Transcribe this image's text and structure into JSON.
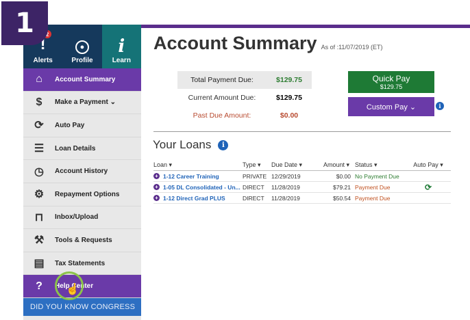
{
  "step_badge": "1",
  "sidebar": {
    "top_icons": [
      {
        "label": "Alerts",
        "icon": "alert-icon",
        "badge": "2"
      },
      {
        "label": "Profile",
        "icon": "profile-icon"
      },
      {
        "label": "Learn",
        "icon": "info-italic-icon",
        "glyph": "i"
      }
    ],
    "items": [
      {
        "label": "Account Summary",
        "icon": "home-icon",
        "glyph": "⌂"
      },
      {
        "label": "Make a Payment ⌄",
        "icon": "dollar-icon",
        "glyph": "$"
      },
      {
        "label": "Auto Pay",
        "icon": "autopay-icon",
        "glyph": "⟳"
      },
      {
        "label": "Loan Details",
        "icon": "list-icon",
        "glyph": "☰"
      },
      {
        "label": "Account History",
        "icon": "clock-icon",
        "glyph": "◷"
      },
      {
        "label": "Repayment Options",
        "icon": "gear-icon",
        "glyph": "⚙"
      },
      {
        "label": "Inbox/Upload",
        "icon": "inbox-icon",
        "glyph": "⊓"
      },
      {
        "label": "Tools & Requests",
        "icon": "wrench-icon",
        "glyph": "⚒"
      },
      {
        "label": "Tax Statements",
        "icon": "document-icon",
        "glyph": "▤"
      },
      {
        "label": "Help Center",
        "icon": "help-icon",
        "glyph": "?"
      }
    ],
    "banner": "DID YOU KNOW CONGRESS"
  },
  "main": {
    "title": "Account Summary",
    "as_of": "As of :11/07/2019 (ET)",
    "summary": {
      "total_label": "Total Payment Due:",
      "total_value": "$129.75",
      "current_label": "Current Amount Due:",
      "current_value": "$129.75",
      "past_label": "Past Due Amount:",
      "past_value": "$0.00"
    },
    "quick_pay": {
      "label": "Quick Pay",
      "amount": "$129.75"
    },
    "custom_pay": "Custom Pay ⌄",
    "loans_title": "Your Loans",
    "loan_columns": [
      "Loan ▾",
      "Type ▾",
      "Due Date ▾",
      "Amount ▾",
      "Status ▾",
      "Auto Pay ▾"
    ],
    "loans": [
      {
        "name": "1-12 Career Training",
        "type": "PRIVATE",
        "due": "12/29/2019",
        "amount": "$0.00",
        "status": "No Payment Due",
        "autopay": ""
      },
      {
        "name": "1-05 DL Consolidated - Un...",
        "type": "DIRECT",
        "due": "11/28/2019",
        "amount": "$79.21",
        "status": "Payment Due",
        "autopay": "⟳"
      },
      {
        "name": "1-12 Direct Grad PLUS",
        "type": "DIRECT",
        "due": "11/28/2019",
        "amount": "$50.54",
        "status": "Payment Due",
        "autopay": ""
      }
    ]
  },
  "colors": {
    "sidebar_active": "#6a3aa8",
    "top_nav": "#15395c",
    "quick_pay": "#1e7a35",
    "accent_blue": "#1f63b8"
  }
}
